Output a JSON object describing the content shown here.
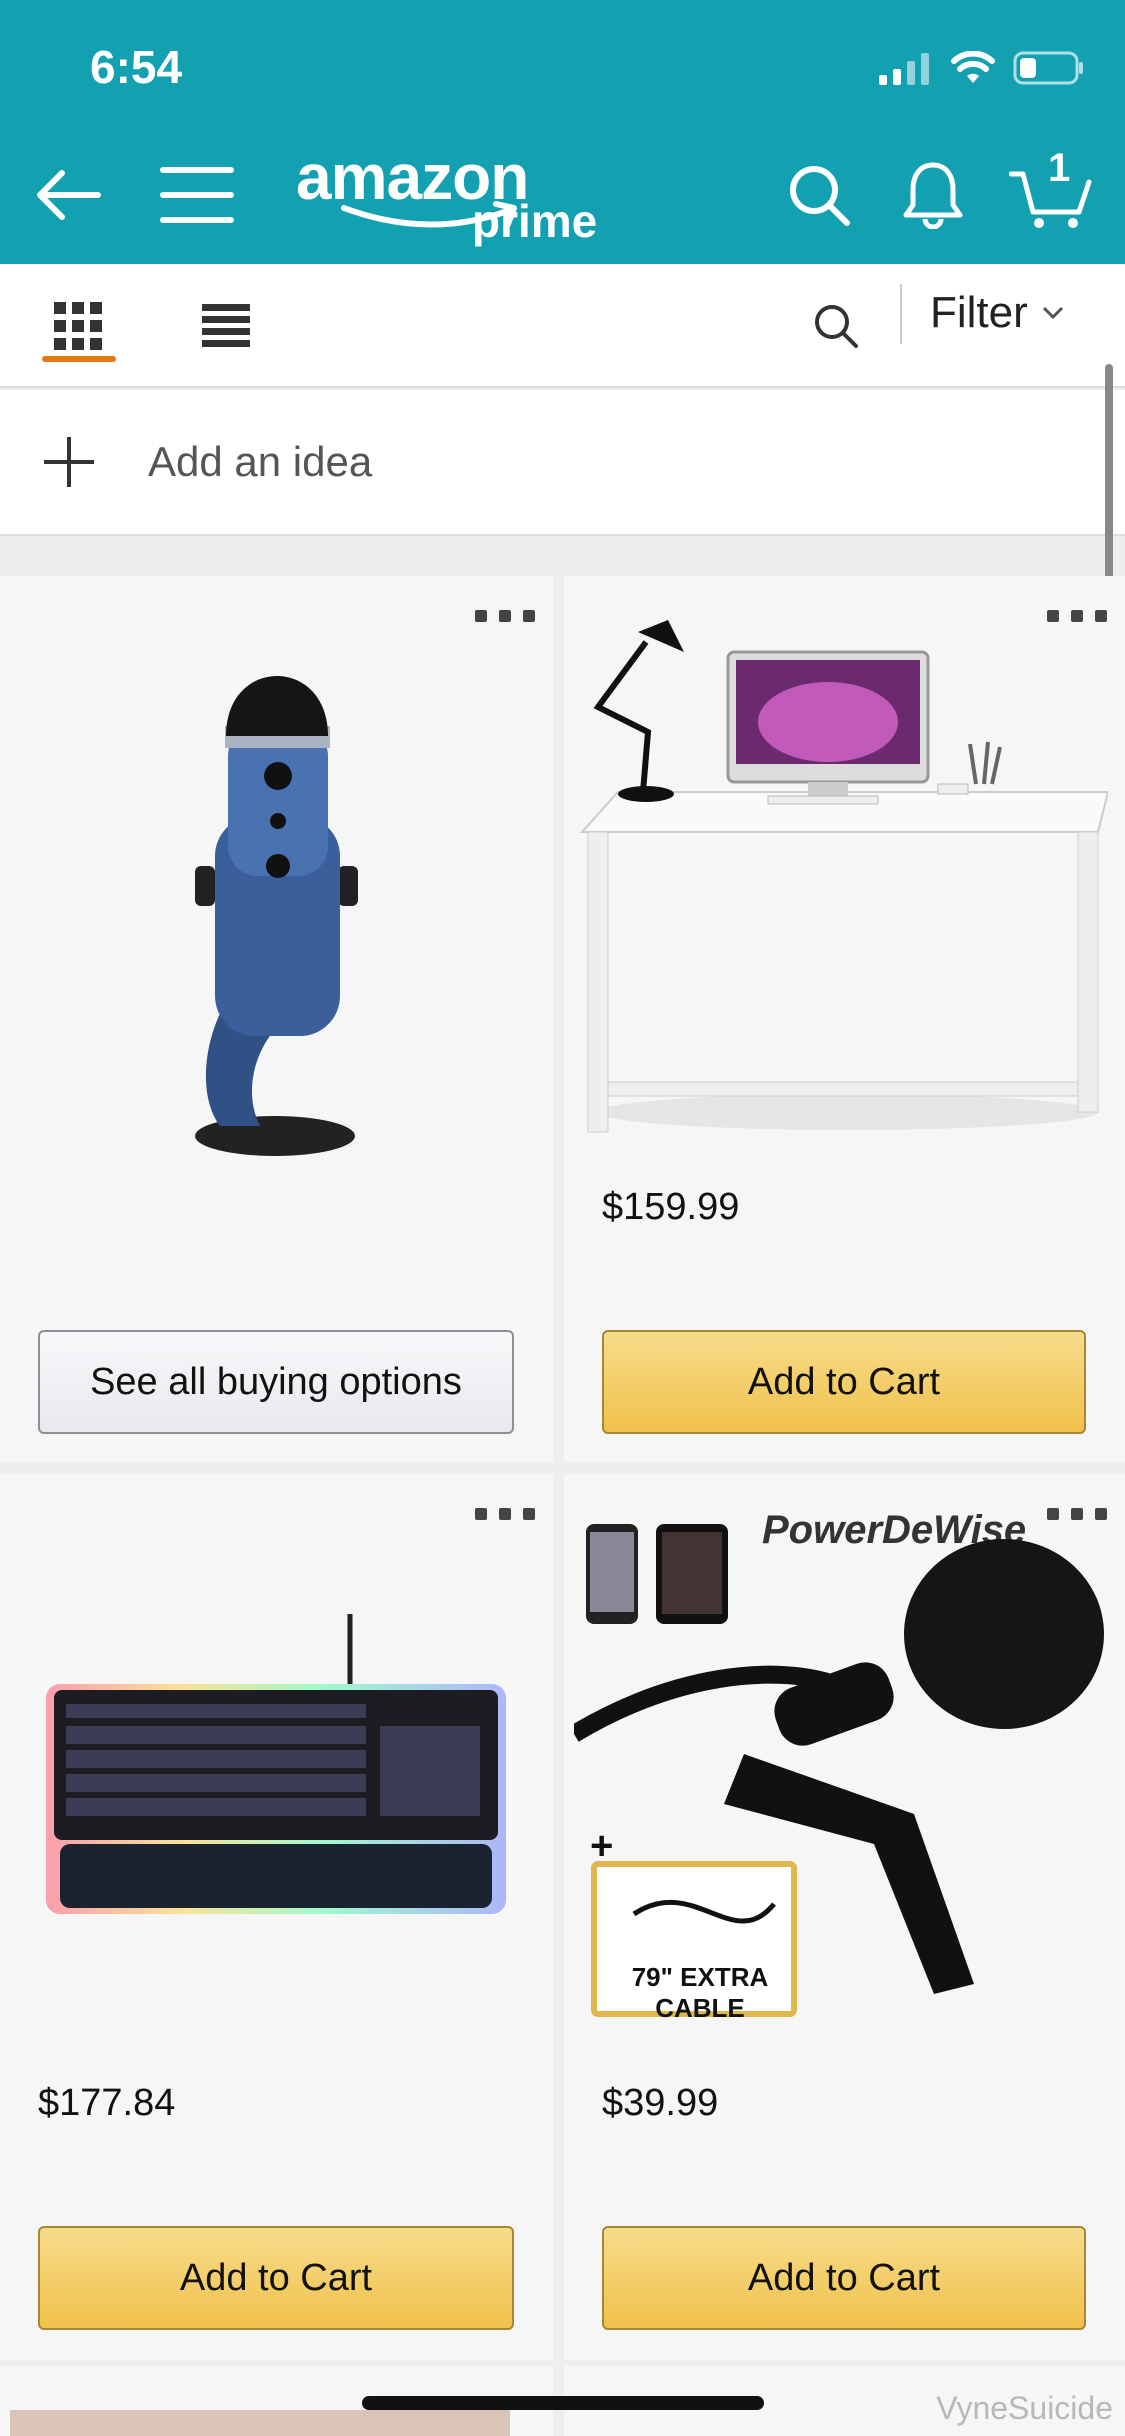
{
  "status_bar": {
    "time": "6:54"
  },
  "header": {
    "logo_text": "amazon",
    "logo_sub": "prime",
    "cart_count": "1",
    "icons": [
      "back-arrow-icon",
      "hamburger-menu-icon",
      "search-icon",
      "bell-icon",
      "cart-icon"
    ]
  },
  "toolbar": {
    "views": [
      "grid-view-icon",
      "list-view-icon"
    ],
    "filter_label": "Filter"
  },
  "add_idea": {
    "label": "Add an idea"
  },
  "products": [
    {
      "name": "Blue Yeti microphone",
      "price": "",
      "button": "See all buying options",
      "button_style": "grey"
    },
    {
      "name": "Desk with computer",
      "price": "$159.99",
      "button": "Add to Cart",
      "button_style": "yellow"
    },
    {
      "name": "RGB keyboard",
      "price": "$177.84",
      "button": "Add to Cart",
      "button_style": "yellow"
    },
    {
      "name": "PowerDeWise lavalier mic",
      "price": "$39.99",
      "button": "Add to Cart",
      "button_style": "yellow",
      "image_text": "PowerDeWise",
      "image_badge": "79\" EXTRA CABLE"
    }
  ],
  "watermark": "VyneSuicide",
  "colors": {
    "header_bg": "#13a0b0",
    "accent": "#e47911",
    "button_yellow": "#f0c14b"
  }
}
